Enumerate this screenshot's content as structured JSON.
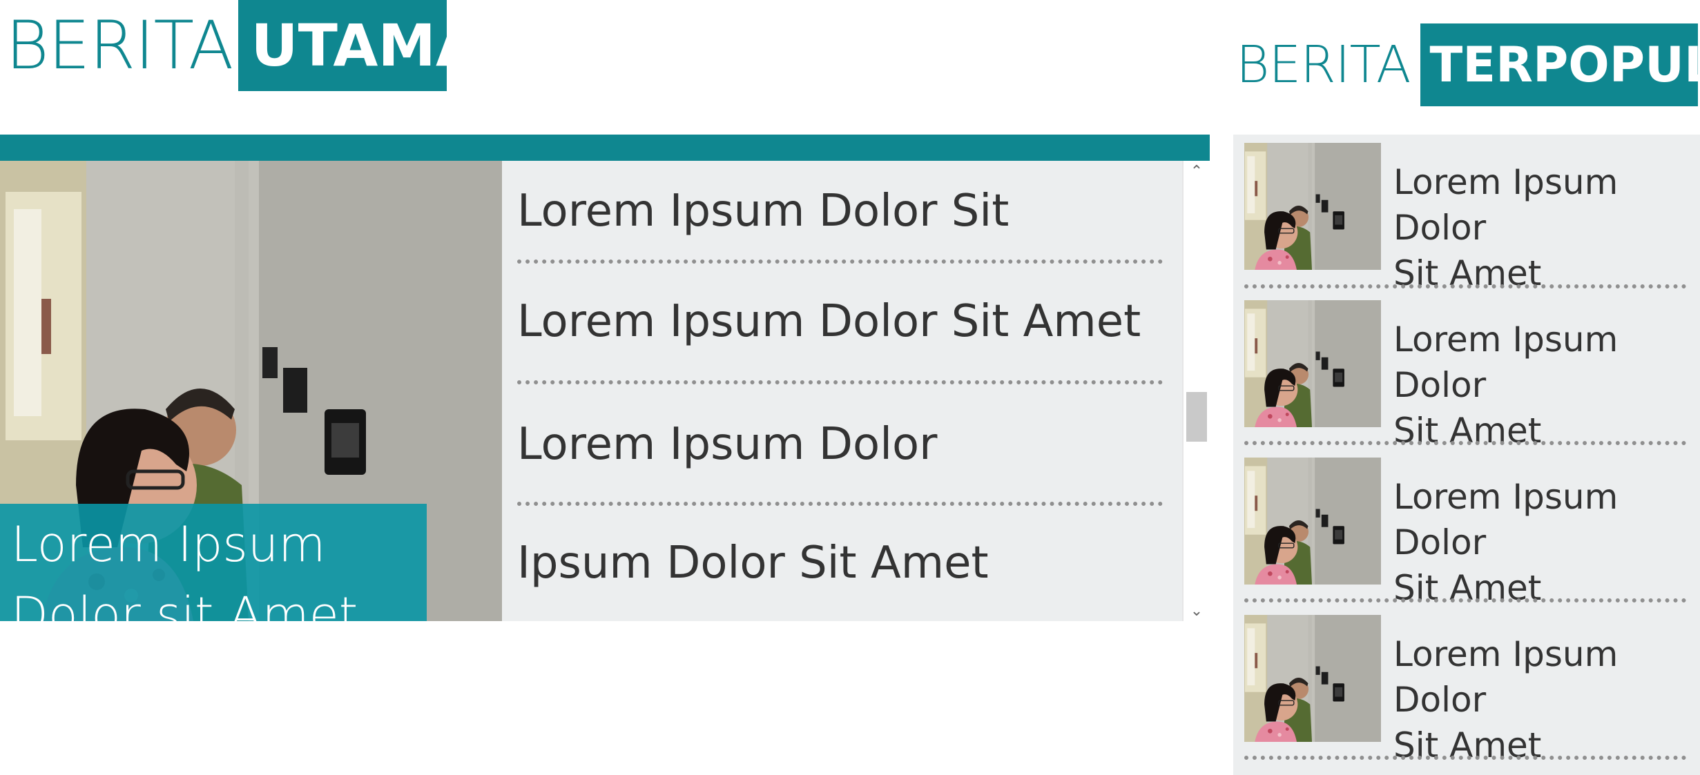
{
  "main_heading": {
    "light": "BERITA",
    "bold": "UTAMA"
  },
  "popular_heading": {
    "light": "BERITA",
    "bold": "TERPOPULER"
  },
  "hero": {
    "caption_line1": "Lorem Ipsum",
    "caption_line2": "Dolor sit Amet"
  },
  "headlines": [
    "Lorem Ipsum Dolor Sit",
    "Lorem Ipsum Dolor Sit Amet",
    "Lorem Ipsum Dolor",
    "Ipsum Dolor Sit Amet"
  ],
  "popular": [
    {
      "line1": "Lorem Ipsum Dolor",
      "line2": "Sit Amet"
    },
    {
      "line1": "Lorem Ipsum Dolor",
      "line2": "Sit Amet"
    },
    {
      "line1": "Lorem Ipsum Dolor",
      "line2": "Sit Amet"
    },
    {
      "line1": "Lorem Ipsum Dolor",
      "line2": "Sit Amet"
    }
  ],
  "scrollbar": {
    "up_icon": "chevron-up-icon",
    "down_icon": "chevron-down-icon"
  },
  "colors": {
    "accent": "#0f8790",
    "caption_bg": "#0a96a5",
    "panel_bg": "#eceeef"
  }
}
